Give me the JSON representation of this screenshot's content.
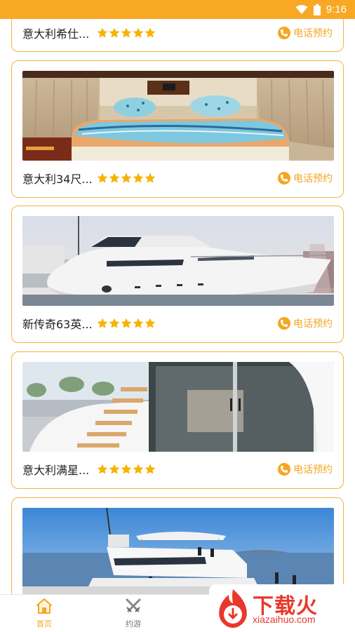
{
  "status_bar": {
    "time": "9:16"
  },
  "cards": [
    {
      "title": "意大利希仕...",
      "rating": 5,
      "action": "电话预约"
    },
    {
      "title": "意大利34尺...",
      "rating": 5,
      "action": "电话预约"
    },
    {
      "title": "新传奇63英...",
      "rating": 5,
      "action": "电话预约"
    },
    {
      "title": "意大利满星...",
      "rating": 5,
      "action": "电话预约"
    }
  ],
  "tabs": [
    {
      "label": "首页",
      "active": true
    },
    {
      "label": "约游",
      "active": false
    }
  ],
  "watermark": {
    "text": "下载火",
    "url": "xiazaihuo.com"
  },
  "colors": {
    "accent": "#f5a623",
    "status_bar": "#f9a825",
    "watermark": "#e8382b"
  }
}
